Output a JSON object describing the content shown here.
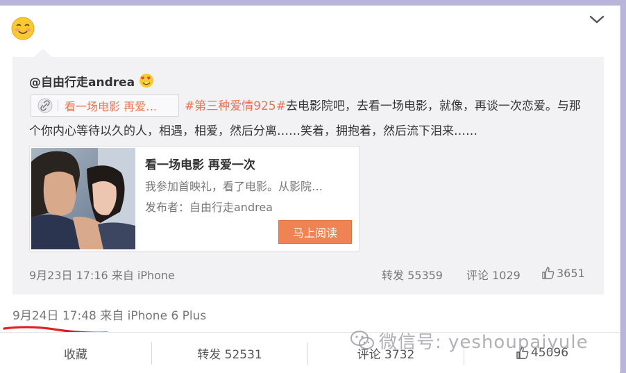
{
  "post": {
    "avatar_icon": "smiling-face-emoji-icon",
    "menu_icon": "chevron-down-icon",
    "timestamp": "9月24日 17:48",
    "source_prefix": "来自",
    "source_device": "iPhone 6 Plus"
  },
  "repost": {
    "author": "@自由行走andrea",
    "author_badge_icon": "heart-eyes-emoji-icon",
    "link_chip_text": "看一场电影 再爱…",
    "hashtag": "#第三种爱情925#",
    "body": "去电影院吧，去看一场电影，就像，再谈一次恋爱。与那个你内心等待以久的人，相遇，相爱，然后分离……笑着，拥抱着，然后流下泪来……",
    "article": {
      "title": "看一场电影 再爱一次",
      "description": "我参加首映礼，看了电影。从影院…",
      "publisher": "发布者：自由行走andrea",
      "read_button": "马上阅读"
    },
    "meta": "9月23日 17:16 来自 iPhone",
    "stats": {
      "reposts": "转发 55359",
      "comments": "评论 1029",
      "likes": "3651"
    }
  },
  "actions": {
    "favorite": "收藏",
    "repost": "转发 52531",
    "comment": "评论 3732",
    "like": "45096"
  },
  "watermark": {
    "text": "微信号: yeshoupaiyule"
  },
  "colors": {
    "accent_orange": "#eb7350",
    "button_orange": "#ef8354",
    "annotation_red": "#e02020",
    "background_lavender": "#b8b4da"
  }
}
